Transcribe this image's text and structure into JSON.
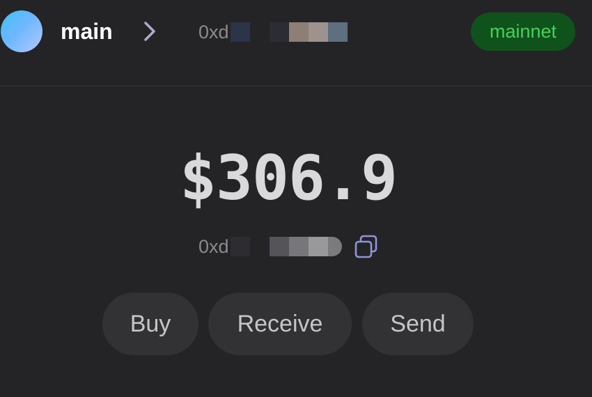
{
  "header": {
    "account_name": "main",
    "address_prefix": "0xd",
    "network": "mainnet"
  },
  "wallet": {
    "balance": "$306.9",
    "address_prefix": "0xd"
  },
  "actions": {
    "buy": "Buy",
    "receive": "Receive",
    "send": "Send"
  },
  "icons": {
    "avatar": "gradient-avatar",
    "chevron": "chevron-right-icon",
    "copy": "copy-icon"
  },
  "colors": {
    "background": "#242426",
    "network_badge_bg": "#10521b",
    "network_badge_text": "#46d05a",
    "button_bg": "#323234",
    "accent_icon": "#8f95d8"
  }
}
